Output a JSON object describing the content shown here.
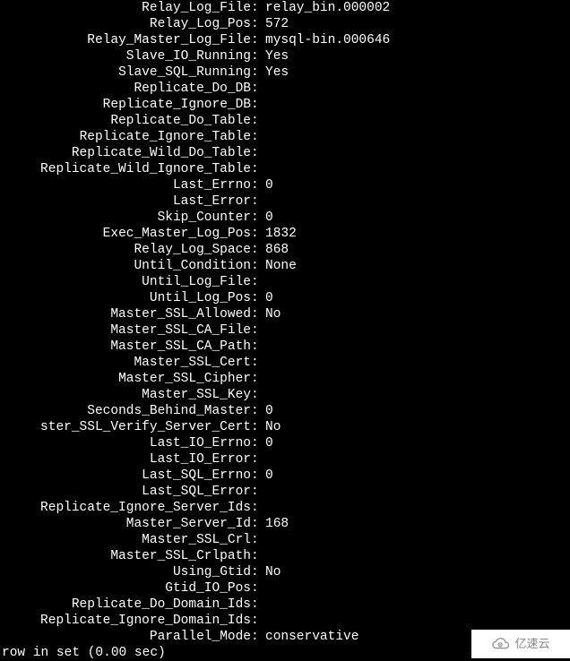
{
  "rows": [
    {
      "label": "Relay_Log_File",
      "value": "relay_bin.000002"
    },
    {
      "label": "Relay_Log_Pos",
      "value": "572"
    },
    {
      "label": "Relay_Master_Log_File",
      "value": "mysql-bin.000646"
    },
    {
      "label": "Slave_IO_Running",
      "value": "Yes"
    },
    {
      "label": "Slave_SQL_Running",
      "value": "Yes"
    },
    {
      "label": "Replicate_Do_DB",
      "value": ""
    },
    {
      "label": "Replicate_Ignore_DB",
      "value": ""
    },
    {
      "label": "Replicate_Do_Table",
      "value": ""
    },
    {
      "label": "Replicate_Ignore_Table",
      "value": ""
    },
    {
      "label": "Replicate_Wild_Do_Table",
      "value": ""
    },
    {
      "label": "Replicate_Wild_Ignore_Table",
      "value": ""
    },
    {
      "label": "Last_Errno",
      "value": "0"
    },
    {
      "label": "Last_Error",
      "value": ""
    },
    {
      "label": "Skip_Counter",
      "value": "0"
    },
    {
      "label": "Exec_Master_Log_Pos",
      "value": "1832"
    },
    {
      "label": "Relay_Log_Space",
      "value": "868"
    },
    {
      "label": "Until_Condition",
      "value": "None"
    },
    {
      "label": "Until_Log_File",
      "value": ""
    },
    {
      "label": "Until_Log_Pos",
      "value": "0"
    },
    {
      "label": "Master_SSL_Allowed",
      "value": "No"
    },
    {
      "label": "Master_SSL_CA_File",
      "value": ""
    },
    {
      "label": "Master_SSL_CA_Path",
      "value": ""
    },
    {
      "label": "Master_SSL_Cert",
      "value": ""
    },
    {
      "label": "Master_SSL_Cipher",
      "value": ""
    },
    {
      "label": "Master_SSL_Key",
      "value": ""
    },
    {
      "label": "Seconds_Behind_Master",
      "value": "0"
    },
    {
      "label": "ster_SSL_Verify_Server_Cert",
      "value": "No"
    },
    {
      "label": "Last_IO_Errno",
      "value": "0"
    },
    {
      "label": "Last_IO_Error",
      "value": ""
    },
    {
      "label": "Last_SQL_Errno",
      "value": "0"
    },
    {
      "label": "Last_SQL_Error",
      "value": ""
    },
    {
      "label": "Replicate_Ignore_Server_Ids",
      "value": ""
    },
    {
      "label": "Master_Server_Id",
      "value": "168"
    },
    {
      "label": "Master_SSL_Crl",
      "value": ""
    },
    {
      "label": "Master_SSL_Crlpath",
      "value": ""
    },
    {
      "label": "Using_Gtid",
      "value": "No"
    },
    {
      "label": "Gtid_IO_Pos",
      "value": ""
    },
    {
      "label": "Replicate_Do_Domain_Ids",
      "value": ""
    },
    {
      "label": "Replicate_Ignore_Domain_Ids",
      "value": ""
    },
    {
      "label": "Parallel_Mode",
      "value": "conservative"
    }
  ],
  "footer": "row in set (0.00 sec)",
  "watermark": {
    "text": "亿速云"
  }
}
